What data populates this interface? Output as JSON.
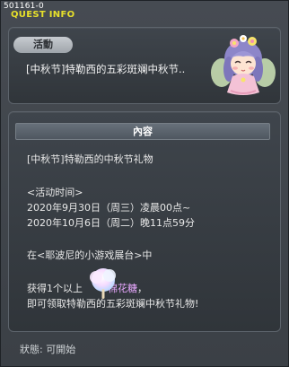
{
  "window": {
    "quest_id": "501161-0",
    "title": "QUEST INFO"
  },
  "quest": {
    "badge": "活動",
    "name": "[中秋节]特勒西的五彩斑斓中秋节..",
    "npc_icon": "fairy-npc-portrait"
  },
  "content": {
    "header": "內容",
    "line1": "[中秋节]特勒西的中秋节礼物",
    "line2": "<活动时间>",
    "line3": "2020年9月30日（周三）凌晨00点~",
    "line4": "2020年10月6日（周二）晚11点59分",
    "line5": "在<耶波尼的小游戏展台>中",
    "line6_prefix": "获得1个以上",
    "item_name": "棉花糖",
    "line6_suffix": "，",
    "line7": "即可领取特勒西的五彩斑斓中秋节礼物!",
    "item_icon": "cotton-candy-icon"
  },
  "footer": {
    "status": "狀態:  可開始"
  },
  "colors": {
    "title": "#e7e02b",
    "item_highlight": "#e8a8ff",
    "panel_border": "#5d646c"
  }
}
